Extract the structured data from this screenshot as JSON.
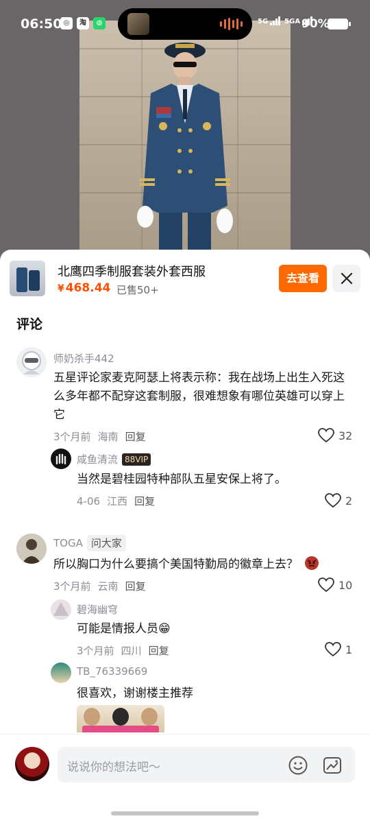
{
  "status_bar": {
    "time": "06:50",
    "app_icons": [
      "netease-icon",
      "taobao-icon",
      "wechat-icon"
    ],
    "net1": "5G",
    "net2": "5GA",
    "battery": "90%"
  },
  "product": {
    "title": "北鹰四季制服套装外套西服",
    "price_symbol": "¥",
    "price": "468.44",
    "sold": "已售50+",
    "view_button": "去查看",
    "close_icon": "close-icon"
  },
  "comments_title": "评论",
  "comments": [
    {
      "user": "师奶杀手442",
      "text": "五星评论家麦克阿瑟上将表示称：我在战场上出生入死这么多年都不配穿这套制服，很难想象有哪位英雄可以穿上它",
      "time": "3个月前",
      "location": "海南",
      "reply": "回复",
      "likes": "32",
      "replies": [
        {
          "user": "咸鱼清流",
          "badge": "88VIP",
          "text": "当然是碧桂园特种部队五星安保上将了。",
          "time": "4-06",
          "location": "江西",
          "reply": "回复",
          "likes": "2"
        }
      ]
    },
    {
      "user": "TOGA",
      "tag": "问大家",
      "text": "所以胸口为什么要搞个美国特勤局的徽章上去？",
      "time": "3个月前",
      "location": "云南",
      "reply": "回复",
      "likes": "10",
      "replies": [
        {
          "user": "碧海幽穹",
          "text": "可能是情报人员😁",
          "time": "3个月前",
          "location": "四川",
          "reply": "回复",
          "likes": "1"
        },
        {
          "user": "TB_76339669",
          "text": "很喜欢，谢谢楼主推荐"
        }
      ]
    }
  ],
  "input": {
    "placeholder": "说说你的想法吧～",
    "emoji_icon": "emoji-icon",
    "image_icon": "image-icon"
  },
  "colors": {
    "accent": "#ff6a00",
    "price": "#ff5000",
    "muted": "#8a8d94"
  }
}
